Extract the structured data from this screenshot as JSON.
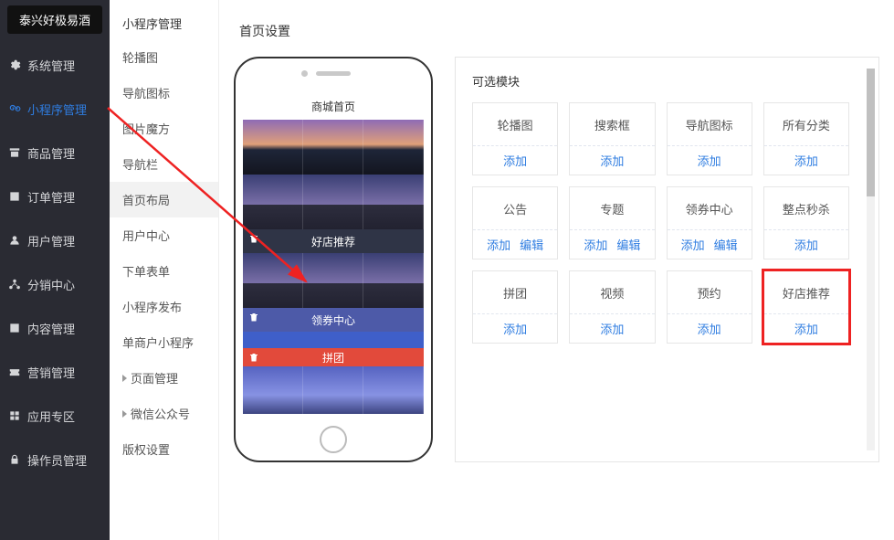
{
  "brand": "泰兴好极易酒",
  "sidebar1": {
    "items": [
      {
        "label": "系统管理"
      },
      {
        "label": "小程序管理"
      },
      {
        "label": "商品管理"
      },
      {
        "label": "订单管理"
      },
      {
        "label": "用户管理"
      },
      {
        "label": "分销中心"
      },
      {
        "label": "内容管理"
      },
      {
        "label": "营销管理"
      },
      {
        "label": "应用专区"
      },
      {
        "label": "操作员管理"
      }
    ]
  },
  "sidebar2": {
    "title": "小程序管理",
    "items": [
      "轮播图",
      "导航图标",
      "图片魔方",
      "导航栏",
      "首页布局",
      "用户中心",
      "下单表单",
      "小程序发布",
      "单商户小程序"
    ],
    "groups": [
      "页面管理",
      "微信公众号"
    ],
    "last": "版权设置"
  },
  "page": {
    "title": "首页设置"
  },
  "phone": {
    "header": "商城首页",
    "bars": {
      "rec": "好店推荐",
      "coupon": "领券中心",
      "group": "拼团"
    }
  },
  "panel": {
    "title": "可选模块",
    "add": "添加",
    "edit": "编辑",
    "cards": [
      {
        "name": "轮播图",
        "acts": [
          "add"
        ]
      },
      {
        "name": "搜索框",
        "acts": [
          "add"
        ]
      },
      {
        "name": "导航图标",
        "acts": [
          "add"
        ]
      },
      {
        "name": "所有分类",
        "acts": [
          "add"
        ]
      },
      {
        "name": "公告",
        "acts": [
          "add",
          "edit"
        ]
      },
      {
        "name": "专题",
        "acts": [
          "add",
          "edit"
        ]
      },
      {
        "name": "领券中心",
        "acts": [
          "add",
          "edit"
        ]
      },
      {
        "name": "整点秒杀",
        "acts": [
          "add"
        ]
      },
      {
        "name": "拼团",
        "acts": [
          "add"
        ]
      },
      {
        "name": "视频",
        "acts": [
          "add"
        ]
      },
      {
        "name": "预约",
        "acts": [
          "add"
        ]
      },
      {
        "name": "好店推荐",
        "acts": [
          "add"
        ],
        "hl": true
      }
    ]
  }
}
